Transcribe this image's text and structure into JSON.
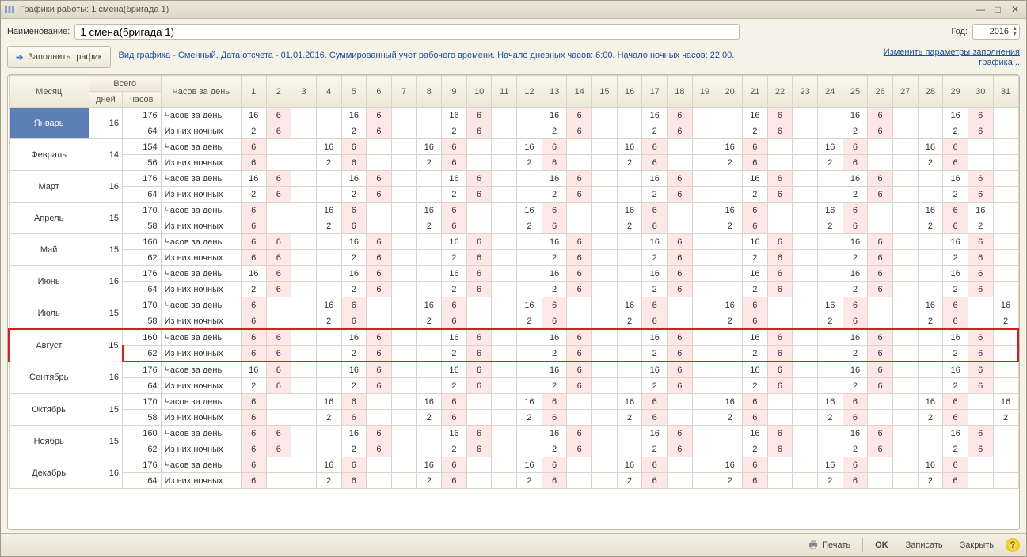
{
  "window": {
    "title": "Графики работы: 1 смена(бригада 1)"
  },
  "form": {
    "name_label": "Наименование:",
    "name_value": "1 смена(бригада 1)",
    "year_label": "Год:",
    "year_value": "2016",
    "fill_button": "Заполнить график",
    "info_text": "Вид графика - Сменный. Дата отсчета - 01.01.2016. Суммированный учет рабочего времени. Начало дневных часов: 6:00. Начало ночных часов: 22:00.",
    "change_link": "Изменить параметры заполнения графика..."
  },
  "footer": {
    "print": "Печать",
    "ok": "OK",
    "save": "Записать",
    "close": "Закрыть"
  },
  "headers": {
    "month": "Месяц",
    "total": "Всего",
    "days": "дней",
    "hours": "часов",
    "hours_per_day": "Часов за день",
    "row_day": "Часов за день",
    "row_night": "Из них ночных"
  },
  "days": 31,
  "highlight_month": "Август",
  "selected_month": "Январь",
  "months": [
    {
      "name": "Январь",
      "days": 16,
      "hours": 176,
      "night_hours": 64,
      "pattern_start": 1
    },
    {
      "name": "Февраль",
      "days": 14,
      "hours": 154,
      "night_hours": 56,
      "pattern_start": 2
    },
    {
      "name": "Март",
      "days": 16,
      "hours": 176,
      "night_hours": 64,
      "pattern_start": 1
    },
    {
      "name": "Апрель",
      "days": 15,
      "hours": 170,
      "night_hours": 58,
      "pattern_start": 2,
      "last_extra": true
    },
    {
      "name": "Май",
      "days": 15,
      "hours": 160,
      "night_hours": 62,
      "pattern_start": 1,
      "variant": "b"
    },
    {
      "name": "Июнь",
      "days": 16,
      "hours": 176,
      "night_hours": 64,
      "pattern_start": 1
    },
    {
      "name": "Июль",
      "days": 15,
      "hours": 170,
      "night_hours": 58,
      "pattern_start": 2,
      "last_extra": true
    },
    {
      "name": "Август",
      "days": 15,
      "hours": 160,
      "night_hours": 62,
      "pattern_start": 1,
      "variant": "b"
    },
    {
      "name": "Сентябрь",
      "days": 16,
      "hours": 176,
      "night_hours": 64,
      "pattern_start": 1
    },
    {
      "name": "Октябрь",
      "days": 15,
      "hours": 170,
      "night_hours": 58,
      "pattern_start": 2,
      "last_extra": true
    },
    {
      "name": "Ноябрь",
      "days": 15,
      "hours": 160,
      "night_hours": 62,
      "pattern_start": 1,
      "variant": "b"
    },
    {
      "name": "Декабрь",
      "days": 16,
      "hours": 176,
      "night_hours": 64,
      "pattern_start": 2
    }
  ],
  "chart_data": {
    "type": "table",
    "title": "Графики работы: 1 смена(бригада 1), 2016",
    "note": "4-day cycle: day1=16h(2 night), day2=6h(6 night), day3=off, day4=off. pattern_start is cycle phase on calendar day 1.",
    "columns": [
      "Месяц",
      "дней",
      "часов (всего)",
      "Из них ночных (всего)"
    ],
    "rows": [
      [
        "Январь",
        16,
        176,
        64
      ],
      [
        "Февраль",
        14,
        154,
        56
      ],
      [
        "Март",
        16,
        176,
        64
      ],
      [
        "Апрель",
        15,
        170,
        58
      ],
      [
        "Май",
        15,
        160,
        62
      ],
      [
        "Июнь",
        16,
        176,
        64
      ],
      [
        "Июль",
        15,
        170,
        58
      ],
      [
        "Август",
        15,
        160,
        62
      ],
      [
        "Сентябрь",
        16,
        176,
        64
      ],
      [
        "Октябрь",
        15,
        170,
        58
      ],
      [
        "Ноябрь",
        15,
        160,
        62
      ],
      [
        "Декабрь",
        16,
        176,
        64
      ]
    ],
    "shift_pattern": {
      "day": [
        16,
        6,
        null,
        null
      ],
      "night": [
        2,
        6,
        null,
        null
      ]
    }
  }
}
